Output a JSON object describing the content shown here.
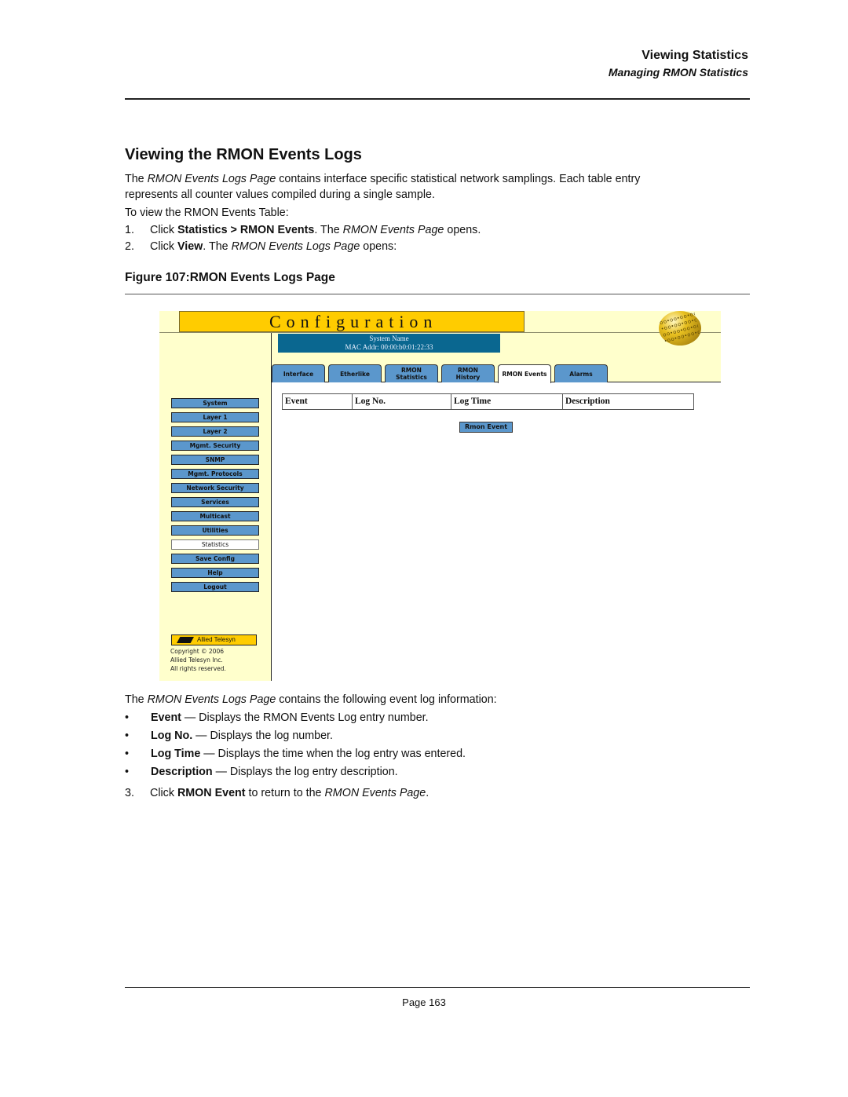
{
  "header": {
    "section": "Viewing Statistics",
    "subsection": "Managing RMON Statistics"
  },
  "heading": "Viewing the RMON Events Logs",
  "intro": {
    "t1": "The ",
    "t1_em": "RMON Events Logs Page",
    "t2": " contains interface specific statistical network samplings. Each table entry",
    "t3": "represents all counter values compiled during a single sample.",
    "t4": "To view the RMON Events Table:"
  },
  "steps": [
    {
      "num": "1.",
      "a": "Click ",
      "b": "Statistics > RMON Events",
      "c": ". The ",
      "em": "RMON Events Page",
      "d": " opens."
    },
    {
      "num": "2.",
      "a": "Click ",
      "b": "View",
      "c": ". The ",
      "em": "RMON Events Logs Page",
      "d": " opens:"
    }
  ],
  "figure_title": "Figure 107:RMON Events Logs Page",
  "screenshot": {
    "banner": "Configuration",
    "system_name": "System Name",
    "mac_addr": "MAC Addr:  00:00:b0:01:22:33",
    "globe_icon": "globe-icon",
    "tabs": [
      {
        "l1": "Interface",
        "l2": ""
      },
      {
        "l1": "Etherlike",
        "l2": ""
      },
      {
        "l1": "RMON",
        "l2": "Statistics"
      },
      {
        "l1": "RMON",
        "l2": "History"
      },
      {
        "l1": "RMON Events",
        "l2": ""
      },
      {
        "l1": "Alarms",
        "l2": ""
      }
    ],
    "active_tab": "RMON Events",
    "table_headers": [
      "Event",
      "Log No.",
      "Log Time",
      "Description"
    ],
    "rmon_event_button": "Rmon Event",
    "menu": [
      "System",
      "Layer 1",
      "Layer 2",
      "Mgmt. Security",
      "SNMP",
      "Mgmt. Protocols",
      "Network Security",
      "Services",
      "Multicast",
      "Utilities",
      "Statistics",
      "Save Config",
      "Help",
      "Logout"
    ],
    "active_menu": "Statistics",
    "logo_text": "Allied Telesyn",
    "copyright": [
      "Copyright © 2006",
      "Allied Telesyn Inc.",
      "All rights reserved."
    ],
    "colors": {
      "banner": "#ffcc00",
      "background": "#ffffcc",
      "button": "#5b97cc",
      "system_box": "#0a6790"
    }
  },
  "after": {
    "t1": "The ",
    "t1_em": "RMON Events Logs Page",
    "t2": " contains the following event log information:",
    "bullets": [
      {
        "b": "Event",
        "t": " — Displays the RMON Events Log entry number."
      },
      {
        "b": "Log No.",
        "t": " — Displays the log number."
      },
      {
        "b": "Log Time",
        "t": " — Displays the time when the log entry was entered."
      },
      {
        "b": "Description",
        "t": " — Displays the log entry description."
      }
    ],
    "step3": {
      "num": "3.",
      "a": "Click ",
      "b": "RMON Event",
      "c": " to return to the ",
      "em": "RMON Events Page",
      "d": "."
    }
  },
  "footer": {
    "page": "Page 163"
  }
}
